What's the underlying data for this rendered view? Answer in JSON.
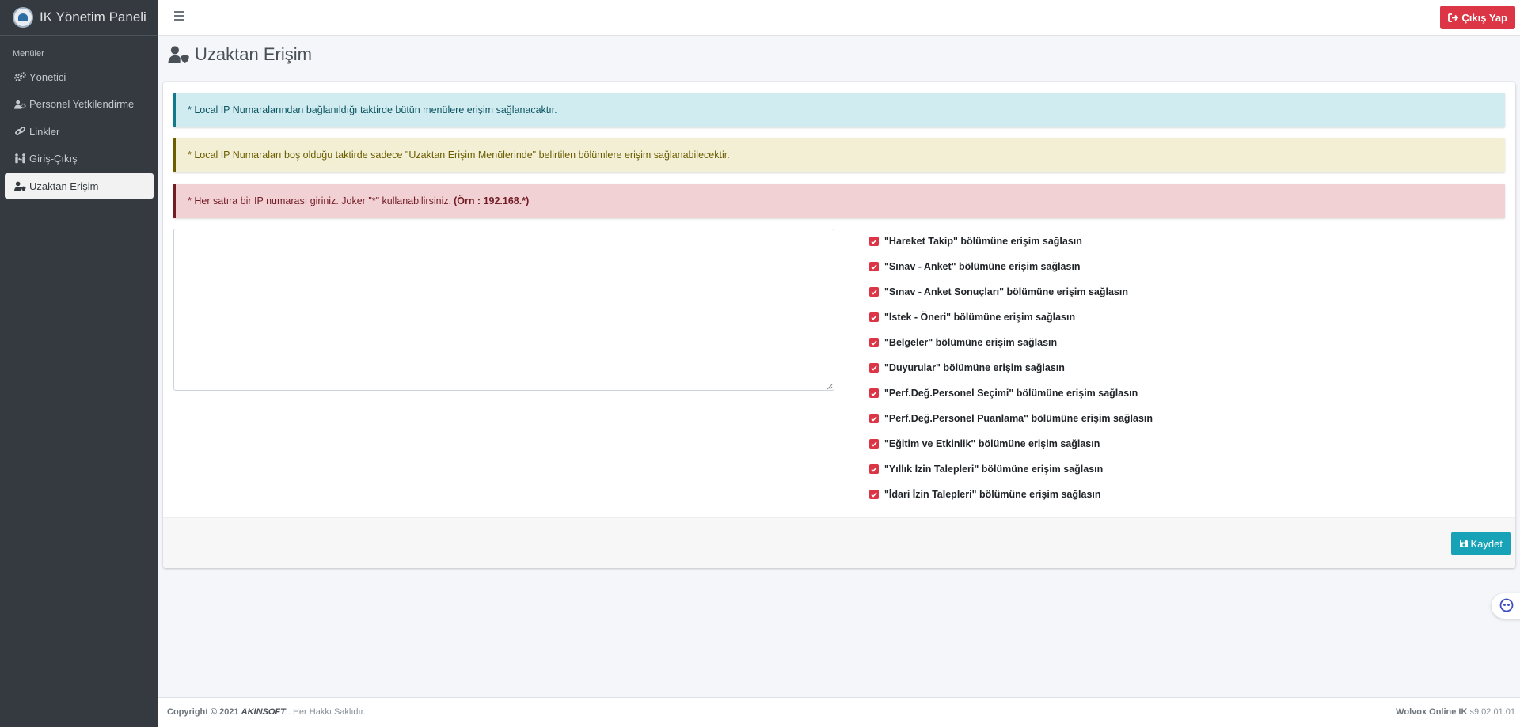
{
  "brand": {
    "title": "IK Yönetim Paneli"
  },
  "sidebar": {
    "header": "Menüler",
    "items": [
      {
        "label": "Yönetici",
        "icon": "gears-icon"
      },
      {
        "label": "Personel Yetkilendirme",
        "icon": "users-cog-icon"
      },
      {
        "label": "Linkler",
        "icon": "link-icon"
      },
      {
        "label": "Giriş-Çıkış",
        "icon": "people-arrows-icon"
      },
      {
        "label": "Uzaktan Erişim",
        "icon": "user-shield-icon",
        "active": true
      }
    ]
  },
  "topbar": {
    "logout_label": "Çıkış Yap"
  },
  "page": {
    "title": "Uzaktan Erişim"
  },
  "alerts": {
    "info": "* Local IP Numaralarından bağlanıldığı taktirde bütün menülere erişim sağlanacaktır.",
    "warning": "* Local IP Numaraları boş olduğu taktirde sadece \"Uzaktan Erişim Menülerinde\" belirtilen bölümlere erişim sağlanabilecektir.",
    "danger": "* Her satıra bir IP numarası giriniz. Joker \"*\" kullanabilirsiniz.",
    "danger_example": "(Örn : 192.168.*)"
  },
  "ip_input": {
    "value": ""
  },
  "checkboxes": [
    {
      "label": "\"Hareket Takip\" bölümüne erişim sağlasın",
      "checked": true
    },
    {
      "label": "\"Sınav - Anket\" bölümüne erişim sağlasın",
      "checked": true
    },
    {
      "label": "\"Sınav - Anket Sonuçları\" bölümüne erişim sağlasın",
      "checked": true
    },
    {
      "label": "\"İstek - Öneri\" bölümüne erişim sağlasın",
      "checked": true
    },
    {
      "label": "\"Belgeler\" bölümüne erişim sağlasın",
      "checked": true
    },
    {
      "label": "\"Duyurular\" bölümüne erişim sağlasın",
      "checked": true
    },
    {
      "label": "\"Perf.Değ.Personel Seçimi\" bölümüne erişim sağlasın",
      "checked": true
    },
    {
      "label": "\"Perf.Değ.Personel Puanlama\" bölümüne erişim sağlasın",
      "checked": true
    },
    {
      "label": "\"Eğitim ve Etkinlik\" bölümüne erişim sağlasın",
      "checked": true
    },
    {
      "label": "\"Yıllık İzin Talepleri\" bölümüne erişim sağlasın",
      "checked": true
    },
    {
      "label": "\"İdari İzin Talepleri\" bölümüne erişim sağlasın",
      "checked": true
    }
  ],
  "save_label": "Kaydet",
  "footer": {
    "copyright": "Copyright © 2021",
    "company": "AKINSOFT",
    "rights": ". Her Hakkı Saklıdır.",
    "product": "Wolvox Online IK",
    "version": "s9.02.01.01"
  },
  "colors": {
    "sidebar_bg": "#343a40",
    "danger": "#dc3545",
    "info": "#17a2b8"
  }
}
